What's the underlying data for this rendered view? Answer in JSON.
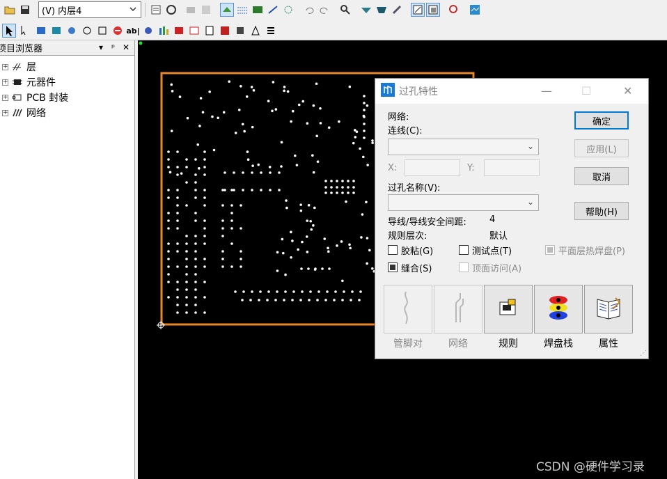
{
  "toolbar": {
    "layer_select_value": "(V) 内层4",
    "row2_text_tool": "ab|"
  },
  "browser": {
    "title": "项目浏览器",
    "items": [
      {
        "label": "层",
        "icon": "layers-icon"
      },
      {
        "label": "元器件",
        "icon": "component-icon"
      },
      {
        "label": "PCB 封装",
        "icon": "footprint-icon"
      },
      {
        "label": "网络",
        "icon": "net-icon"
      }
    ]
  },
  "dialog": {
    "title": "过孔特性",
    "net_label": "网络:",
    "route_label": "连线(C):",
    "x_label": "X:",
    "y_label": "Y:",
    "via_name_label": "过孔名称(V):",
    "clearance_label": "导线/导线安全间距:",
    "clearance_value": "4",
    "rule_level_label": "规则层次:",
    "rule_level_value": "默认",
    "cb_glue": "胶粘(G)",
    "cb_testpoint": "测试点(T)",
    "cb_plane_thermal": "平面层热焊盘(P)",
    "cb_stitch": "缝合(S)",
    "cb_top_access": "顶面访问(A)",
    "btn_ok": "确定",
    "btn_apply": "应用(L)",
    "btn_cancel": "取消",
    "btn_help": "帮助(H)",
    "big_buttons": [
      {
        "label": "管脚对",
        "enabled": false
      },
      {
        "label": "网络",
        "enabled": false
      },
      {
        "label": "规则",
        "enabled": true
      },
      {
        "label": "焊盘栈",
        "enabled": true
      },
      {
        "label": "属性",
        "enabled": true
      }
    ]
  },
  "watermark": "CSDN @硬件学习录",
  "colors": {
    "board_outline": "#e8872a",
    "canvas_bg": "#000000",
    "via": "#ffffff",
    "accent": "#0078d7"
  }
}
